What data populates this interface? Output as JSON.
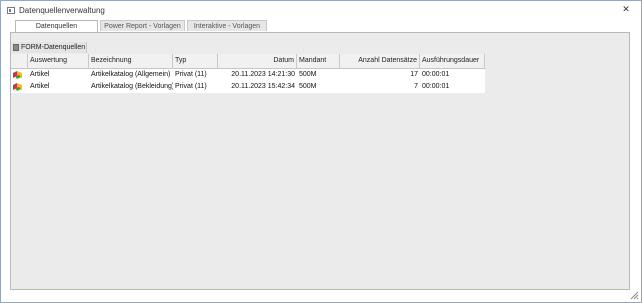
{
  "window": {
    "title": "Datenquellenverwaltung",
    "close_glyph": "✕"
  },
  "tabs": [
    {
      "label": "Datenquellen",
      "active": true
    },
    {
      "label": "Power Report - Vorlagen",
      "active": false
    },
    {
      "label": "Interaktive - Vorlagen",
      "active": false
    }
  ],
  "group": {
    "label": "FORM-Datenquellen",
    "icon": "folder-icon"
  },
  "grid": {
    "columns": [
      {
        "key": "auswertung",
        "label": "Auswertung"
      },
      {
        "key": "bezeichnung",
        "label": "Bezeichnung"
      },
      {
        "key": "typ",
        "label": "Typ"
      },
      {
        "key": "datum",
        "label": "Datum"
      },
      {
        "key": "mandant",
        "label": "Mandant"
      },
      {
        "key": "anzahl",
        "label": "Anzahl Datensätze"
      },
      {
        "key": "dauer",
        "label": "Ausführungsdauer"
      }
    ],
    "rows": [
      {
        "icon": "cube-icon",
        "auswertung": "Artikel",
        "bezeichnung": "Artikelkatalog (Allgemein)",
        "typ": "Privat (11)",
        "datum": "20.11.2023 14:21:30",
        "mandant": "500M",
        "anzahl": "17",
        "dauer": "00:00:01"
      },
      {
        "icon": "cube-icon",
        "auswertung": "Artikel",
        "bezeichnung": "Artikelkatalog (Bekleidung)",
        "typ": "Privat (11)",
        "datum": "20.11.2023 15:42:34",
        "mandant": "500M",
        "anzahl": "7",
        "dauer": "00:00:01"
      }
    ]
  },
  "colors": {
    "panel_bg": "#ebebeb",
    "icon_red": "#d9302c",
    "icon_yellow": "#e8c21e",
    "icon_green": "#3f9a3a"
  }
}
